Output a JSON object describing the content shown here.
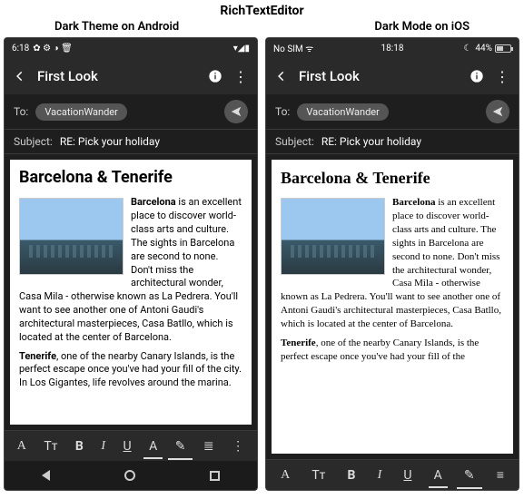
{
  "main_title": "RichTextEditor",
  "labels": {
    "android": "Dark Theme on Android",
    "ios": "Dark Mode on iOS"
  },
  "android": {
    "status": {
      "time": "6:18",
      "icons_left": "✿ ⚙ ◑ 🗑",
      "icons_right": "▾◢▮"
    },
    "appbar": {
      "title": "First Look"
    },
    "to_label": "To:",
    "to_chip": "VacationWander",
    "subject_label": "Subject:",
    "subject_value": "RE: Pick your holiday",
    "doc": {
      "heading": "Barcelona & Tenerife",
      "p1_bold": "Barcelona",
      "p1_rest": " is an excellent place to discover world-class arts and culture. The sights in Barcelona are second to none. Don't miss the architectural wonder, Casa Mila - otherwise known as La Pedrera. You'll want to see another one of Antoni Gaudi's architectural masterpieces, Casa Batllo, which is located at the center of Barcelona.",
      "p2_bold": "Tenerife",
      "p2_rest": ", one of the nearby Canary Islands, is the perfect escape once you've had your fill of the city. In Los Gigantes, life revolves around the marina."
    },
    "toolbar": {
      "font": "A",
      "size": "Tт",
      "bold": "B",
      "italic": "I",
      "underline": "U",
      "fontcolor": "A",
      "highlight": "✎",
      "list": "≣",
      "more": "⋮"
    }
  },
  "ios": {
    "status": {
      "left": "No SIM ᯤ",
      "center": "18:18",
      "right_pct": "44%",
      "moon": "☾"
    },
    "appbar": {
      "title": "First Look"
    },
    "to_label": "To:",
    "to_chip": "VacationWander",
    "subject_label": "Subject:",
    "subject_value": "RE: Pick your holiday",
    "doc": {
      "heading": "Barcelona & Tenerife",
      "p1_bold": "Barcelona",
      "p1_rest": " is an excellent place to discover world-class arts and culture. The sights in Barcelona are second to none. Don't miss the architectural wonder, Casa Mila - otherwise known as La Pedrera. You'll want to see another one of Antoni Gaudi's architectural masterpieces, Casa Batllo, which is located at the center of Barcelona.",
      "p2_bold": "Tenerife",
      "p2_rest": ", one of the nearby Canary Islands, is the perfect escape once you've had your fill of the"
    },
    "toolbar": {
      "font": "A",
      "size": "Tт",
      "bold": "B",
      "italic": "I",
      "underline": "U",
      "fontcolor": "A",
      "highlight": "✎",
      "align": "≡"
    }
  }
}
